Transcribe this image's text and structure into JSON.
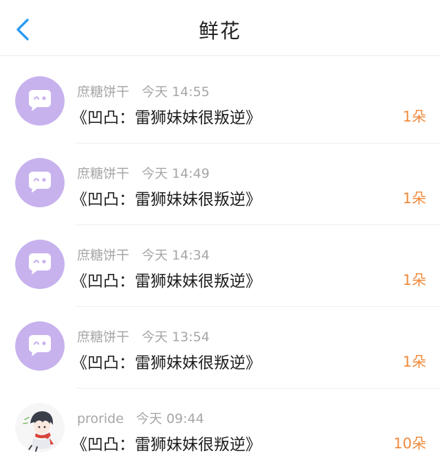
{
  "header": {
    "title": "鲜花",
    "back_icon": "chevron-left-icon",
    "accent": "#2a9af0"
  },
  "records": [
    {
      "user": "庶糖饼干",
      "time": "今天 14:55",
      "book": "《凹凸：雷狮妹妹很叛逆》",
      "flowers": "1朵",
      "avatar": "default-chat-bubble-avatar"
    },
    {
      "user": "庶糖饼干",
      "time": "今天 14:49",
      "book": "《凹凸：雷狮妹妹很叛逆》",
      "flowers": "1朵",
      "avatar": "default-chat-bubble-avatar"
    },
    {
      "user": "庶糖饼干",
      "time": "今天 14:34",
      "book": "《凹凸：雷狮妹妹很叛逆》",
      "flowers": "1朵",
      "avatar": "default-chat-bubble-avatar"
    },
    {
      "user": "庶糖饼干",
      "time": "今天 13:54",
      "book": "《凹凸：雷狮妹妹很叛逆》",
      "flowers": "1朵",
      "avatar": "default-chat-bubble-avatar"
    },
    {
      "user": "proride",
      "time": "今天 09:44",
      "book": "《凹凸：雷狮妹妹很叛逆》",
      "flowers": "10朵",
      "avatar": "anime-character-avatar"
    }
  ],
  "colors": {
    "avatar_bg": "#c7b2ee",
    "flower_count": "#f28a3c",
    "meta_text": "#a6a6a6"
  }
}
